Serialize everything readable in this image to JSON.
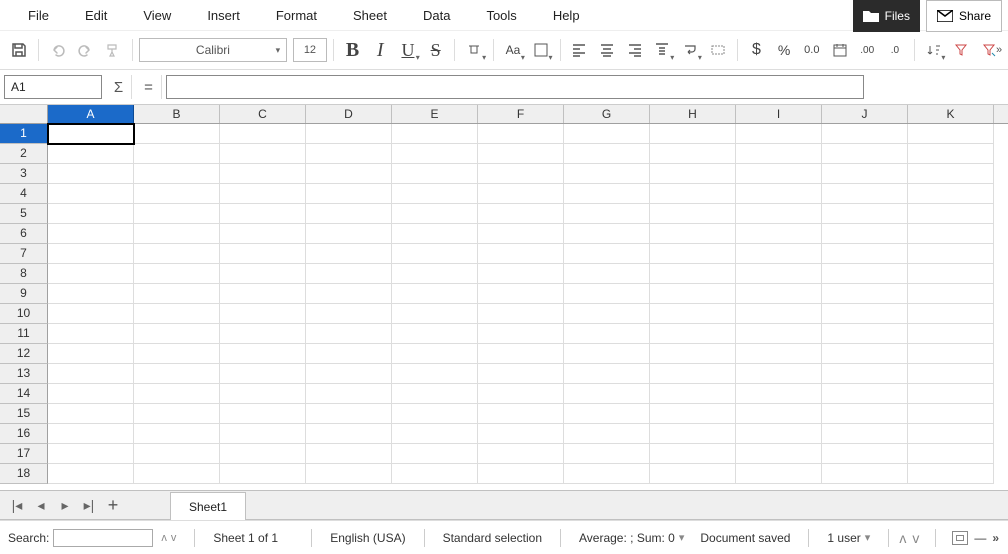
{
  "menu": [
    "File",
    "Edit",
    "View",
    "Insert",
    "Format",
    "Sheet",
    "Data",
    "Tools",
    "Help"
  ],
  "topbuttons": {
    "files": "Files",
    "share": "Share"
  },
  "toolbar": {
    "font": "Calibri",
    "size": "12",
    "aa": "Aa"
  },
  "formula": {
    "cellref": "A1",
    "value": ""
  },
  "grid": {
    "cols": [
      "A",
      "B",
      "C",
      "D",
      "E",
      "F",
      "G",
      "H",
      "I",
      "J",
      "K"
    ],
    "rows": 18,
    "active": {
      "row": 1,
      "col": "A"
    }
  },
  "sheets": {
    "active": "Sheet1"
  },
  "status": {
    "search_label": "Search:",
    "sheetinfo": "Sheet 1 of 1",
    "lang": "English (USA)",
    "selection": "Standard selection",
    "stats": "Average: ; Sum: 0",
    "saved": "Document saved",
    "users": "1 user"
  }
}
